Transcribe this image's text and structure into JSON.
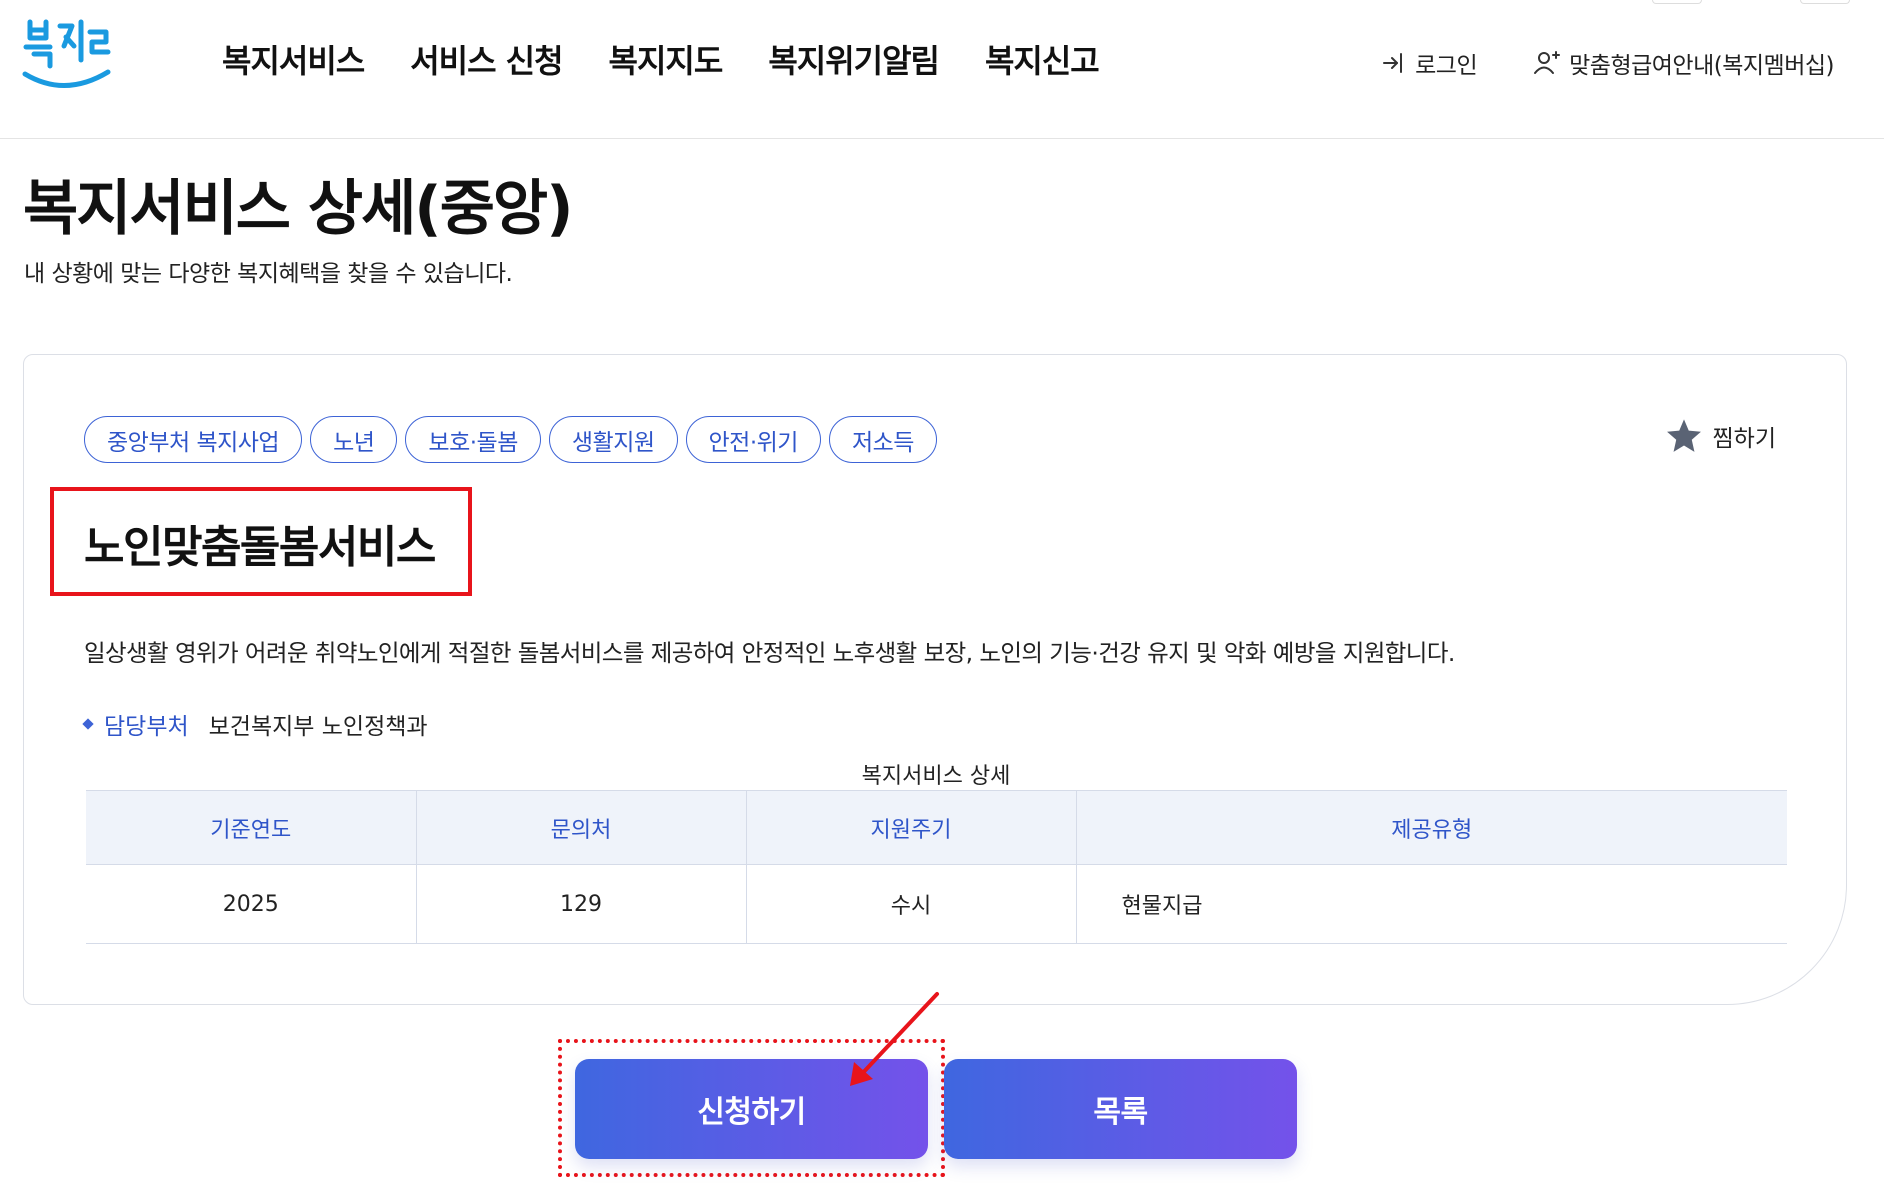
{
  "header": {
    "logo_text": "복지로",
    "nav": [
      "복지서비스",
      "서비스 신청",
      "복지지도",
      "복지위기알림",
      "복지신고"
    ],
    "login_label": "로그인",
    "membership_label": "맞춤형급여안내(복지멤버십)"
  },
  "page": {
    "title": "복지서비스 상세(중앙)",
    "description": "내 상황에 맞는 다양한 복지혜택을 찾을 수 있습니다."
  },
  "service": {
    "tags": [
      "중앙부처 복지사업",
      "노년",
      "보호·돌봄",
      "생활지원",
      "안전·위기",
      "저소득"
    ],
    "favorite_label": "찜하기",
    "name": "노인맞춤돌봄서비스",
    "summary": "일상생활 영위가 어려운 취약노인에게 적절한 돌봄서비스를 제공하여 안정적인 노후생활 보장, 노인의 기능·건강 유지 및 악화 예방을 지원합니다.",
    "dept_label": "담당부처",
    "dept_value": "보건복지부 노인정책과"
  },
  "detail_table": {
    "caption": "복지서비스 상세",
    "headers": [
      "기준연도",
      "문의처",
      "지원주기",
      "제공유형"
    ],
    "row": [
      "2025",
      "129",
      "수시",
      "현물지급"
    ]
  },
  "buttons": {
    "apply": "신청하기",
    "list": "목록"
  },
  "colors": {
    "accent": "#3d63d6",
    "highlight": "#e8141b",
    "button_gradient_start": "#3f67e0",
    "button_gradient_end": "#7452ea"
  }
}
